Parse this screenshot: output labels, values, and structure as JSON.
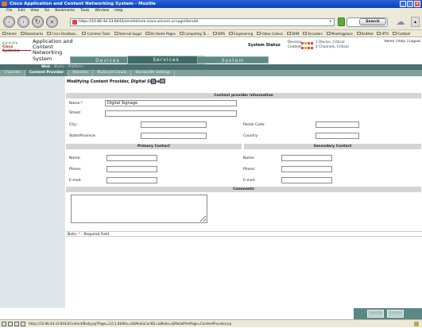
{
  "window": {
    "title": "Cisco Application and Content Networking System - Mozilla",
    "controls": [
      "minimize",
      "maximize",
      "close"
    ]
  },
  "menu": [
    "File",
    "Edit",
    "View",
    "Go",
    "Bookmarks",
    "Tools",
    "Window",
    "Help"
  ],
  "nav": {
    "url": "https://10.86.44.33:8443/servlet/com.cisco.unicorn.ui.LoginServlet",
    "search_label": "Search"
  },
  "bookmarks": [
    "Home",
    "Bookmarks",
    "Cisco Dashboa...",
    "Common Tools",
    "Internal Suppt",
    "BU Home Pages",
    "Competing Te...",
    "DMS",
    "Engineering",
    "Video Codecs",
    "DRM",
    "Encoders",
    "Meetingplace",
    "RedHat",
    "IPTV",
    "Football"
  ],
  "header": {
    "logo": "Cisco Systems",
    "app_title": "Application and Content Networking System",
    "system_status_label": "System Status",
    "devices_label": "Devices:",
    "devices_text": "1 Device, Critical",
    "content_label": "Content:",
    "content_text": "2 Channels, Critical",
    "links": "Home | Help | Logout"
  },
  "tabs": [
    "Devices",
    "Services",
    "System"
  ],
  "subnav": {
    "items": [
      "Web",
      "Media",
      "Platform"
    ]
  },
  "subtabs": [
    "Channels",
    "Content Provider",
    "Websites",
    "Multicast Clouds",
    "Bandwidth Settings"
  ],
  "page": {
    "heading": "Modifying Content Provider,",
    "heading_name": "Digital Signage"
  },
  "form": {
    "info_header": "Content provider information",
    "name_label": "Name:",
    "name_value": "Digital Signage",
    "street_label": "Street:",
    "city_label": "City:",
    "postal_label": "Postal Code:",
    "state_label": "State/Province:",
    "country_label": "Country:",
    "primary_header": "Primary Contact",
    "secondary_header": "Secondary Contact",
    "primary_name_label": "Name:",
    "primary_phone_label": "Phone:",
    "primary_email_label": "E-mail:",
    "secondary_name_label": "Name:",
    "secondary_phone_label": "Phone:",
    "secondary_email_label": "E-mail:",
    "comments_header": "Comments"
  },
  "note": {
    "label": "Note:",
    "star": "*",
    "text": "- Required Field"
  },
  "actions": {
    "submit": "Submit",
    "cancel": "Cancel"
  },
  "status": {
    "url": "https://10.86.44.33:8443/Content/Body.jsp?Page=2,0,1,0&fIdx=0&MediaConfID=&Mode=&ModelPrmPage=ContentProvider.jsp"
  },
  "colors": {
    "tab_bar": "#5d8a85",
    "subnav": "#4c6f6f",
    "subtabs": "#7f9f9b",
    "critical": "#d64a3a"
  }
}
